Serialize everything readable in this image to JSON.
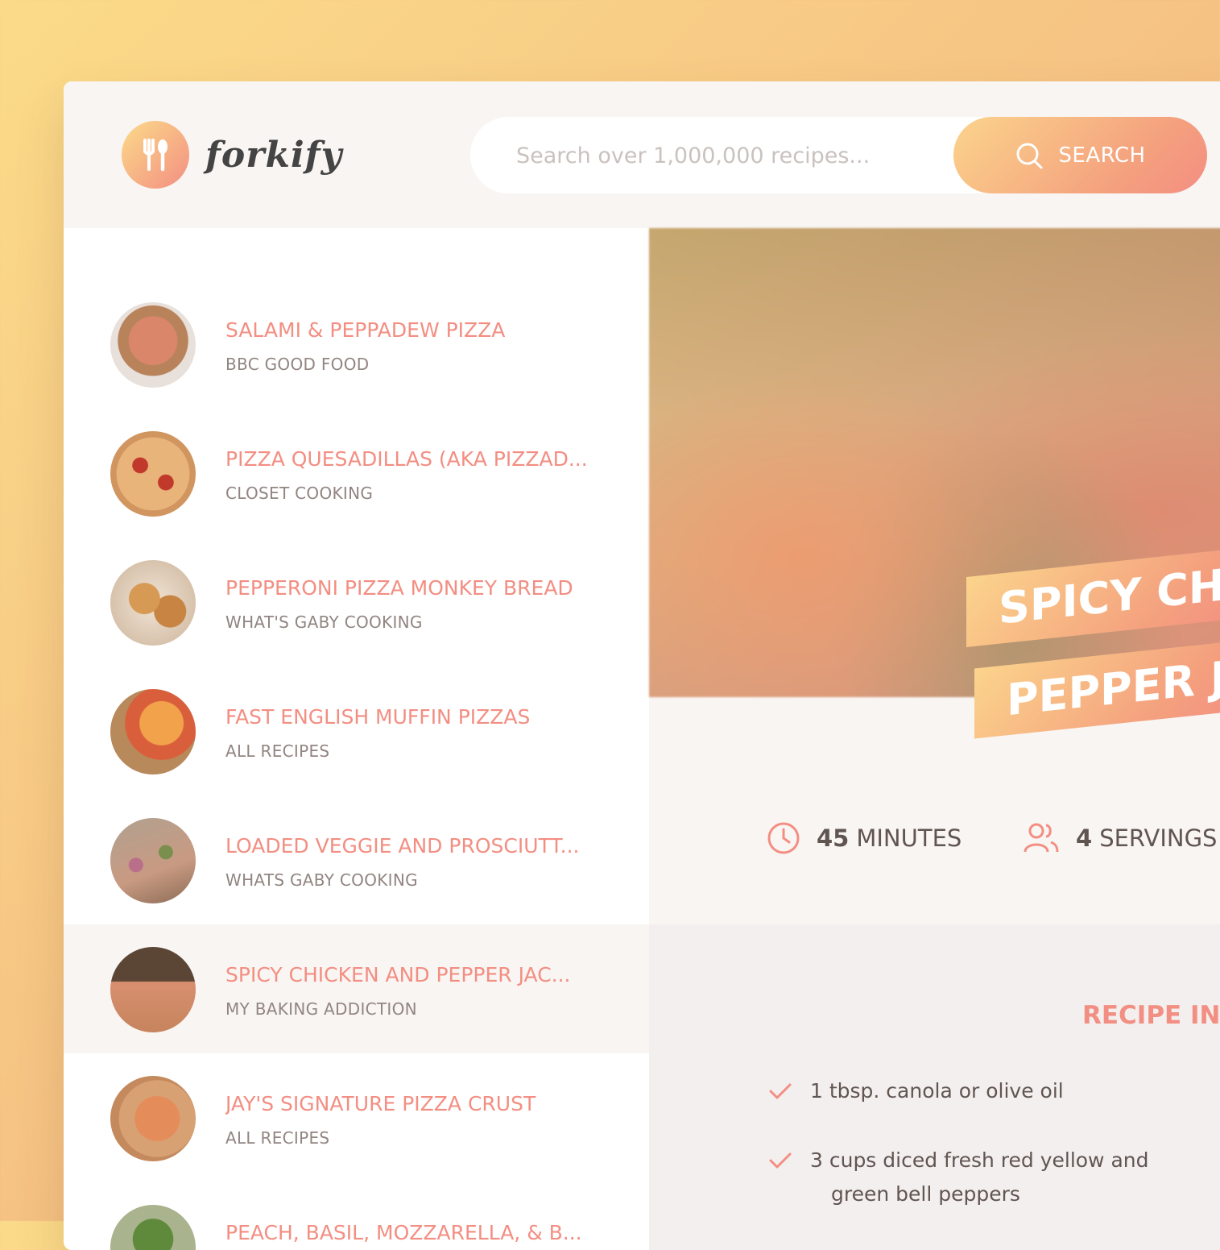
{
  "colors": {
    "accent": "#f38e82",
    "accent_light": "#fbdb89",
    "text": "#615551",
    "muted": "#918581"
  },
  "header": {
    "logo_icon": "fork-knife-icon",
    "brand": "forkify",
    "search": {
      "placeholder": "Search over 1,000,000 recipes...",
      "value": "",
      "button_label": "SEARCH",
      "button_icon": "search-icon"
    }
  },
  "results": [
    {
      "title": "SALAMI & PEPPADEW PIZZA",
      "publisher": "BBC GOOD FOOD",
      "active": false
    },
    {
      "title": "PIZZA QUESADILLAS (AKA PIZZAD...",
      "publisher": "CLOSET COOKING",
      "active": false
    },
    {
      "title": "PEPPERONI PIZZA MONKEY BREAD",
      "publisher": "WHAT'S GABY COOKING",
      "active": false
    },
    {
      "title": "FAST ENGLISH MUFFIN PIZZAS",
      "publisher": "ALL RECIPES",
      "active": false
    },
    {
      "title": "LOADED VEGGIE AND PROSCIUTT...",
      "publisher": "WHATS GABY COOKING",
      "active": false
    },
    {
      "title": "SPICY CHICKEN AND PEPPER JAC...",
      "publisher": "MY BAKING ADDICTION",
      "active": true
    },
    {
      "title": "JAY'S SIGNATURE PIZZA CRUST",
      "publisher": "ALL RECIPES",
      "active": false
    },
    {
      "title": "PEACH, BASIL, MOZZARELLA, & B...",
      "publisher": "",
      "active": false
    }
  ],
  "recipe": {
    "title_line1": "SPICY CH",
    "title_line2": "PEPPER J",
    "time_value": "45",
    "time_unit": "MINUTES",
    "time_icon": "clock-icon",
    "servings_value": "4",
    "servings_unit": "SERVINGS",
    "servings_icon": "users-icon",
    "ingredients_heading": "RECIPE IN",
    "ingredients": [
      {
        "line1": "1 tbsp. canola or olive oil",
        "line2": ""
      },
      {
        "line1": "3 cups diced fresh red yellow and",
        "line2": "green bell peppers"
      }
    ]
  }
}
